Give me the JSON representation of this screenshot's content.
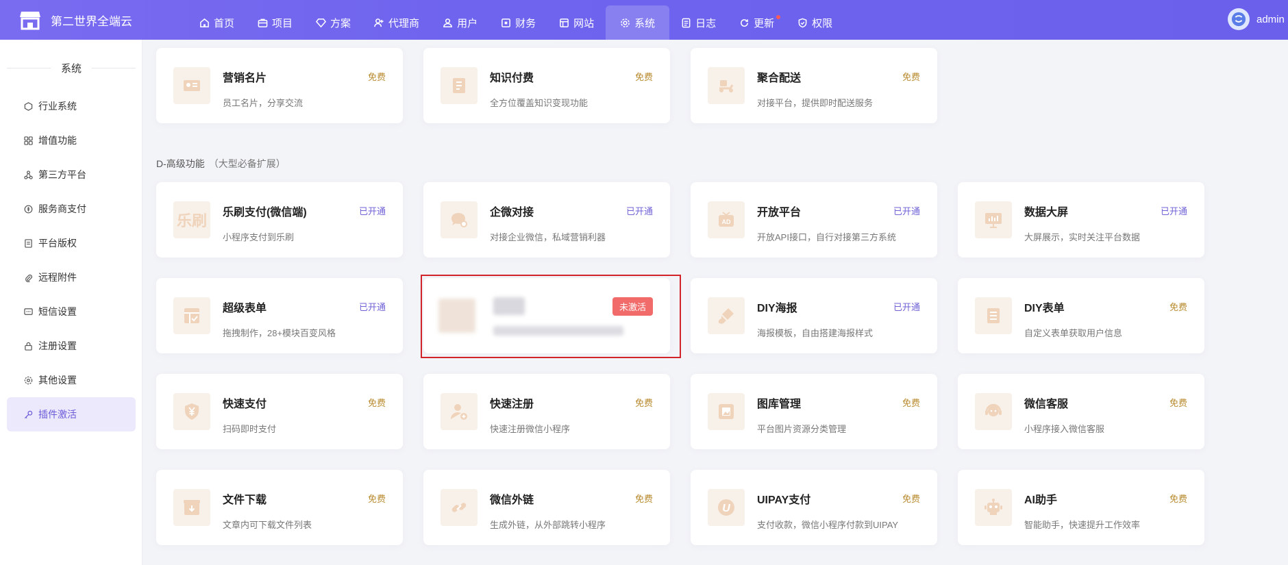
{
  "app": {
    "title": "第二世界全端云"
  },
  "nav": [
    {
      "label": "首页",
      "icon": "home-icon"
    },
    {
      "label": "项目",
      "icon": "briefcase-icon"
    },
    {
      "label": "方案",
      "icon": "diamond-icon"
    },
    {
      "label": "代理商",
      "icon": "user-plus-icon"
    },
    {
      "label": "用户",
      "icon": "users-icon"
    },
    {
      "label": "财务",
      "icon": "finance-icon"
    },
    {
      "label": "网站",
      "icon": "window-icon"
    },
    {
      "label": "系统",
      "icon": "gear-icon",
      "active": true
    },
    {
      "label": "日志",
      "icon": "log-icon"
    },
    {
      "label": "更新",
      "icon": "refresh-icon",
      "dot": true
    },
    {
      "label": "权限",
      "icon": "shield-icon"
    }
  ],
  "user": {
    "name": "admin"
  },
  "sidebar": {
    "title": "系统",
    "items": [
      {
        "label": "行业系统"
      },
      {
        "label": "增值功能"
      },
      {
        "label": "第三方平台"
      },
      {
        "label": "服务商支付"
      },
      {
        "label": "平台版权"
      },
      {
        "label": "远程附件"
      },
      {
        "label": "短信设置"
      },
      {
        "label": "注册设置"
      },
      {
        "label": "其他设置"
      },
      {
        "label": "插件激活",
        "active": true
      }
    ]
  },
  "section": {
    "title": "D-高级功能",
    "subtitle": "（大型必备扩展）"
  },
  "top_cards": [
    {
      "title": "营销名片",
      "desc": "员工名片，分享交流",
      "status": "免费"
    },
    {
      "title": "知识付费",
      "desc": "全方位覆盖知识变现功能",
      "status": "免费"
    },
    {
      "title": "聚合配送",
      "desc": "对接平台，提供即时配送服务",
      "status": "免费"
    }
  ],
  "row1": [
    {
      "title": "乐刷支付(微信端)",
      "desc": "小程序支付到乐刷",
      "status": "已开通",
      "icon_text": "乐刷"
    },
    {
      "title": "企微对接",
      "desc": "对接企业微信，私域营销利器",
      "status": "已开通"
    },
    {
      "title": "开放平台",
      "desc": "开放API接口，自行对接第三方系统",
      "status": "已开通",
      "icon_text": "AD"
    },
    {
      "title": "数据大屏",
      "desc": "大屏展示，实时关注平台数据",
      "status": "已开通"
    }
  ],
  "row2": [
    {
      "title": "超级表单",
      "desc": "拖拽制作，28+模块百变风格",
      "status": "已开通"
    },
    {
      "status": "未激活"
    },
    {
      "title": "DIY海报",
      "desc": "海报模板，自由搭建海报样式",
      "status": "已开通"
    },
    {
      "title": "DIY表单",
      "desc": "自定义表单获取用户信息",
      "status": "免费"
    }
  ],
  "row3": [
    {
      "title": "快速支付",
      "desc": "扫码即时支付",
      "status": "免费"
    },
    {
      "title": "快速注册",
      "desc": "快速注册微信小程序",
      "status": "免费"
    },
    {
      "title": "图库管理",
      "desc": "平台图片资源分类管理",
      "status": "免费"
    },
    {
      "title": "微信客服",
      "desc": "小程序接入微信客服",
      "status": "免费"
    }
  ],
  "row4": [
    {
      "title": "文件下载",
      "desc": "文章内可下载文件列表",
      "status": "免费"
    },
    {
      "title": "微信外链",
      "desc": "生成外链，从外部跳转小程序",
      "status": "免费"
    },
    {
      "title": "UIPAY支付",
      "desc": "支付收款，微信小程序付款到UIPAY",
      "status": "免费",
      "icon_text": "U"
    },
    {
      "title": "AI助手",
      "desc": "智能助手，快速提升工作效率",
      "status": "免费"
    }
  ],
  "colors": {
    "accent": "#6f64ee",
    "free": "#b88a2e",
    "open": "#6f62d6",
    "inactive": "#f16b6b",
    "highlight": "#d2222a"
  }
}
